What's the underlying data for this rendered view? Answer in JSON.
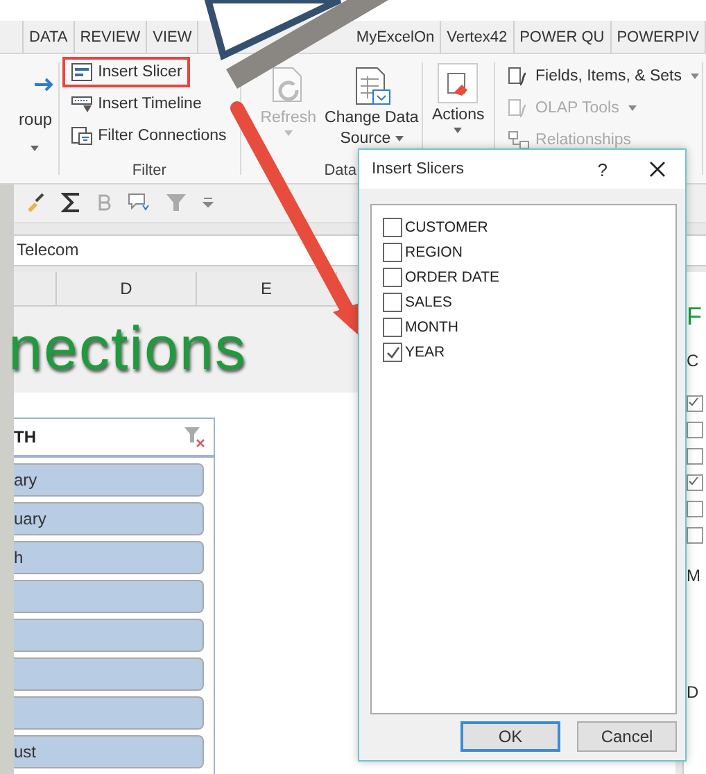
{
  "ribbon_tabs": [
    {
      "label": "DATA"
    },
    {
      "label": "REVIEW"
    },
    {
      "label": "VIEW"
    },
    {
      "label": "MyExcelOn"
    },
    {
      "label": "Vertex42"
    },
    {
      "label": "POWER QU"
    },
    {
      "label": "POWERPIV"
    }
  ],
  "ribbon": {
    "left_group": {
      "label": "roup"
    },
    "filter_group": {
      "label": "Filter",
      "items": [
        {
          "label": "Insert Slicer",
          "highlighted": true
        },
        {
          "label": "Insert Timeline",
          "highlighted": false
        },
        {
          "label": "Filter Connections",
          "highlighted": false
        }
      ]
    },
    "data_group": {
      "label": "Data",
      "refresh": {
        "label": "Refresh",
        "disabled": true
      },
      "change_source": {
        "line1": "Change Data",
        "line2": "Source",
        "disabled": false
      }
    },
    "actions": {
      "label": "Actions"
    },
    "olap_items": [
      {
        "label": "Fields, Items, & Sets",
        "disabled": false,
        "caret": true
      },
      {
        "label": "OLAP Tools",
        "disabled": true,
        "caret": true
      },
      {
        "label": "Relationships",
        "disabled": true,
        "caret": false
      }
    ]
  },
  "formula_bar": {
    "value": "Telecom"
  },
  "columns": [
    "D",
    "E"
  ],
  "sheet_title": "nections",
  "slicer": {
    "header": "TH",
    "items": [
      {
        "label": "ary",
        "selected": true
      },
      {
        "label": "uary",
        "selected": true
      },
      {
        "label": "h",
        "selected": true
      },
      {
        "selected": true
      },
      {
        "selected": true
      },
      {
        "selected": true
      },
      {
        "selected": true
      },
      {
        "label": "ust",
        "selected": true
      }
    ]
  },
  "side_panel": {
    "title": "F",
    "subtitle": "C",
    "checkboxes": [
      {
        "checked": true
      },
      {
        "checked": false
      },
      {
        "checked": false
      },
      {
        "checked": true
      },
      {
        "checked": false
      },
      {
        "checked": false
      }
    ],
    "section_label": "M",
    "footer_label": "D"
  },
  "dialog": {
    "title": "Insert Slicers",
    "help": "?",
    "fields": [
      {
        "label": "CUSTOMER",
        "checked": false
      },
      {
        "label": "REGION",
        "checked": false
      },
      {
        "label": "ORDER DATE",
        "checked": false
      },
      {
        "label": "SALES",
        "checked": false
      },
      {
        "label": "MONTH",
        "checked": false
      },
      {
        "label": "YEAR",
        "checked": true
      }
    ],
    "buttons": [
      {
        "label": "OK",
        "default": true
      },
      {
        "label": "Cancel",
        "default": false
      }
    ]
  }
}
